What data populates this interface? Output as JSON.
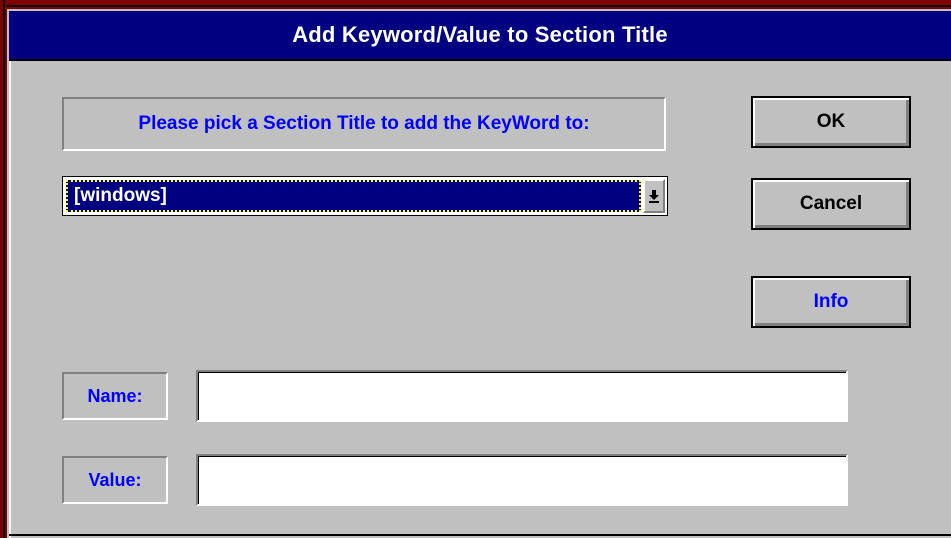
{
  "window": {
    "title": "Add Keyword/Value to Section Title"
  },
  "prompt": {
    "label": "Please pick a Section Title to add the KeyWord to:"
  },
  "section_select": {
    "selected": "[windows]"
  },
  "buttons": {
    "ok_label": "OK",
    "cancel_label": "Cancel",
    "info_label": "Info"
  },
  "fields": {
    "name_label": "Name:",
    "name_value": "",
    "value_label": "Value:",
    "value_value": ""
  },
  "icons": {
    "dropdown": "dropdown-arrow-icon"
  },
  "colors": {
    "title_bar": "#000080",
    "label_text": "#0000ff",
    "window_bg": "#c0c0c0",
    "frame": "#800000",
    "selection_bg": "#000080",
    "focus_dots": "#ffff00"
  }
}
